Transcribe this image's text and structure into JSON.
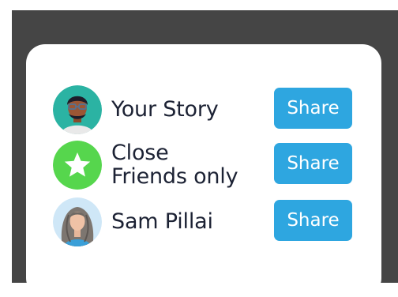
{
  "share_sheet": {
    "colors": {
      "backdrop": "#454545",
      "share_button": "#2ea6e0",
      "close_friends_badge": "#56d64d",
      "text": "#1c2234"
    },
    "items": [
      {
        "label": "Your Story",
        "avatar_icon": "user-avatar-icon",
        "button_label": "Share"
      },
      {
        "label_line1": "Close",
        "label_line2": "Friends only",
        "avatar_icon": "star-icon",
        "button_label": "Share"
      },
      {
        "label": "Sam Pillai",
        "avatar_icon": "user-avatar-icon",
        "button_label": "Share"
      }
    ]
  }
}
